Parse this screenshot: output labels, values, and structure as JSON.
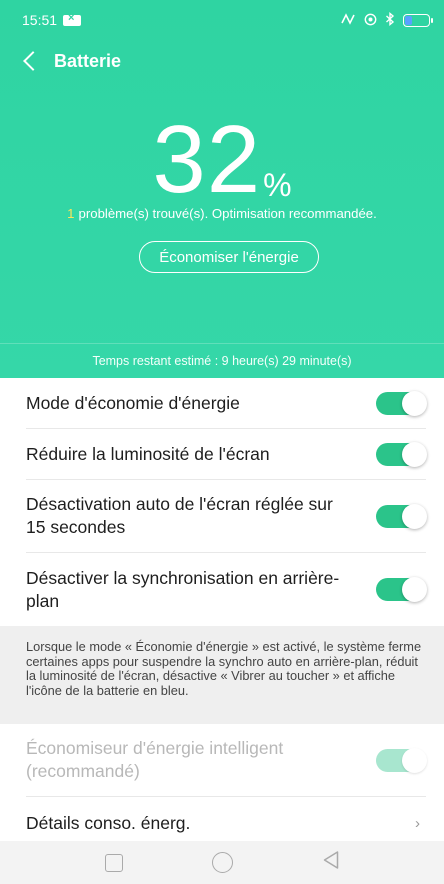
{
  "status_bar": {
    "time": "15:51",
    "icons": [
      "mail-badge-icon",
      "nfc-icon",
      "location-icon",
      "bluetooth-icon",
      "battery-icon"
    ],
    "battery_level": 0.32,
    "battery_color": "#5aa0ff"
  },
  "header": {
    "title": "Batterie",
    "back_icon": "chevron-left-icon",
    "percent_value": "32",
    "percent_unit": "%",
    "problems_count": "1",
    "problems_text": "problème(s) trouvé(s). Optimisation recommandée.",
    "save_button_label": "Économiser l'énergie",
    "remaining_time": "Temps restant estimé : 9 heure(s) 29 minute(s)",
    "accent_color": "#2fd4a2",
    "highlight_color": "#ffe45c"
  },
  "settings": {
    "power_saving": {
      "label": "Mode d'économie d'énergie",
      "on": true
    },
    "reduce_brightness": {
      "label": "Réduire la luminosité de l'écran",
      "on": true
    },
    "auto_screen_off": {
      "label": "Désactivation auto de l'écran réglée sur 15 secondes",
      "on": true
    },
    "disable_sync": {
      "label": "Désactiver la synchronisation en arrière-plan",
      "on": true
    },
    "info": "Lorsque le mode « Économie d'énergie » est activé, le système ferme certaines apps pour suspendre la synchro auto en arrière-plan, réduit la luminosité de l'écran, désactive « Vibrer au toucher » et affiche l'icône de la batterie en bleu.",
    "smart_saver": {
      "label": "Économiseur d'énergie intelligent (recommandé)",
      "on": true,
      "disabled": true
    },
    "details": {
      "label": "Détails conso. énerg.",
      "chevron": "›"
    }
  },
  "toggle_color": "#2bc48a",
  "navbar": {
    "icons": [
      "recent-apps-icon",
      "home-icon",
      "back-icon"
    ]
  }
}
